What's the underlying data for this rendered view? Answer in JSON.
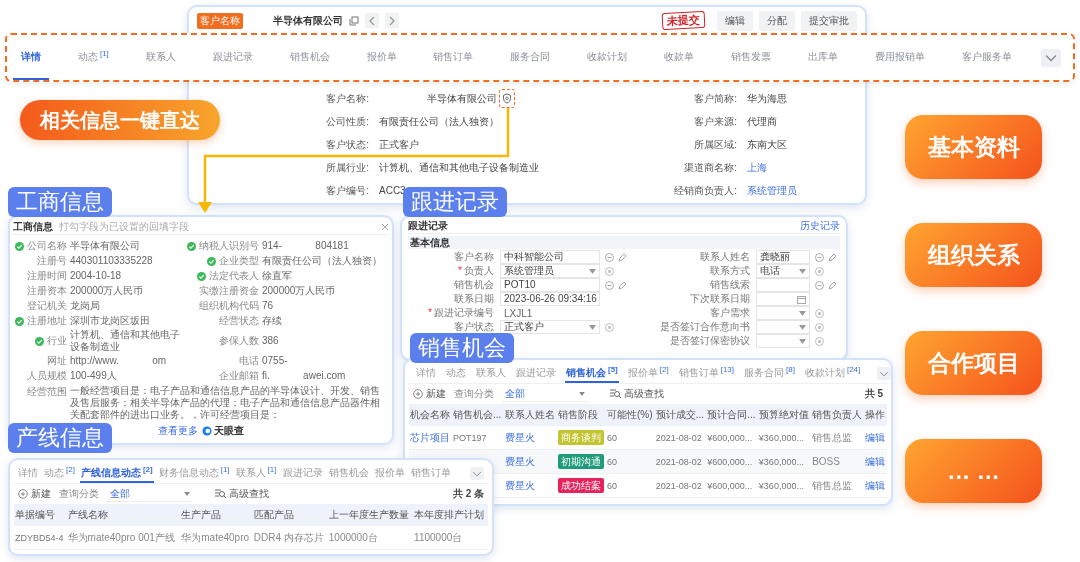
{
  "customer_window": {
    "badge": "客户名称",
    "name": "半导体有限公司",
    "status_stamp": "未提交",
    "buttons": [
      "编辑",
      "分配",
      "提交审批"
    ],
    "rows": [
      {
        "left": {
          "label": "客户名称:",
          "value": "半导体有限公司",
          "link": false,
          "flagged": true
        },
        "right": {
          "label": "客户简称:",
          "value": "华为海思",
          "link": false,
          "flagged": false
        }
      },
      {
        "left": {
          "label": "公司性质:",
          "value": "有限责任公司（法人独资）",
          "link": false,
          "flagged": false
        },
        "right": {
          "label": "客户来源:",
          "value": "代理商",
          "link": false,
          "flagged": false
        }
      },
      {
        "left": {
          "label": "客户状态:",
          "value": "正式客户",
          "link": false,
          "flagged": false
        },
        "right": {
          "label": "所属区域:",
          "value": "东南大区",
          "link": false,
          "flagged": false
        }
      },
      {
        "left": {
          "label": "所属行业:",
          "value": "计算机、通信和其他电子设备制造业",
          "link": false,
          "flagged": false
        },
        "right": {
          "label": "渠道商名称:",
          "value": "上海",
          "link": true,
          "flagged": false
        }
      },
      {
        "left": {
          "label": "客户编号:",
          "value": "ACC3",
          "link": false,
          "flagged": false
        },
        "right": {
          "label": "经销商负责人:",
          "value": "系统管理员",
          "link": true,
          "flagged": false
        }
      }
    ]
  },
  "tab_strip": [
    {
      "label": "详情",
      "selected": true
    },
    {
      "label": "动态",
      "count": "[1]",
      "selected": false
    },
    {
      "label": "联系人",
      "selected": false
    },
    {
      "label": "跟进记录",
      "selected": false
    },
    {
      "label": "销售机会",
      "selected": false
    },
    {
      "label": "报价单",
      "selected": false
    },
    {
      "label": "销售订单",
      "selected": false
    },
    {
      "label": "服务合同",
      "selected": false
    },
    {
      "label": "收款计划",
      "selected": false
    },
    {
      "label": "收款单",
      "selected": false
    },
    {
      "label": "销售发票",
      "selected": false
    },
    {
      "label": "出库单",
      "selected": false
    },
    {
      "label": "费用报销单",
      "selected": false
    },
    {
      "label": "客户服务单",
      "selected": false
    }
  ],
  "callout": "相关信息一键直达",
  "feature_pills": [
    "基本资料",
    "组织关系",
    "合作项目",
    "… …"
  ],
  "business_info": {
    "section_label": "工商信息",
    "title": "工商信息",
    "hint": "打勾字段为已设置的回填字段",
    "rows": [
      {
        "left": {
          "label": "公司名称",
          "value": "半导体有限公司",
          "verified": true
        },
        "right": {
          "label": "纳税人识别号",
          "value": "914-            804181",
          "verified": true
        }
      },
      {
        "left": {
          "label": "注册号",
          "value": "440301103335228",
          "verified": false
        },
        "right": {
          "label": "企业类型",
          "value": "有限责任公司（法人独资）",
          "verified": true
        }
      },
      {
        "left": {
          "label": "注册时间",
          "value": "2004-10-18",
          "verified": false
        },
        "right": {
          "label": "法定代表人",
          "value": "徐直军",
          "verified": true
        }
      },
      {
        "left": {
          "label": "注册资本",
          "value": "200000万人民币",
          "verified": false
        },
        "right": {
          "label": "实缴注册资金",
          "value": "200000万人民币",
          "verified": false
        }
      },
      {
        "left": {
          "label": "登记机关",
          "value": "龙岗局",
          "verified": false
        },
        "right": {
          "label": "组织机构代码",
          "value": "76",
          "verified": false
        }
      },
      {
        "left": {
          "label": "注册地址",
          "value": "深圳市龙岗区坂田",
          "verified": true
        },
        "right": {
          "label": "经营状态",
          "value": "存续",
          "verified": false
        }
      },
      {
        "left": {
          "label": "行业",
          "value": "计算机、通信和其他电子设备制造业",
          "verified": true
        },
        "right": {
          "label": "参保人数",
          "value": "386",
          "verified": false
        }
      },
      {
        "left": {
          "label": "网址",
          "value": "http://www.            om",
          "verified": false
        },
        "right": {
          "label": "电话",
          "value": "0755-",
          "verified": false
        }
      },
      {
        "left": {
          "label": "人员规模",
          "value": "100-499人",
          "verified": false
        },
        "right": {
          "label": "企业邮箱",
          "value": "fi.            awei.com",
          "verified": false
        }
      }
    ],
    "scope": {
      "label": "经营范围",
      "value": "一般经营项目是：电子产品和通信信息产品的半导体设计、开发、销售及售后服务；相关半导体产品的代理；电子产品和通信信息产品器件相关配套部件的进出口业务。，许可经营项目是："
    },
    "more_link": "查看更多",
    "source": "天眼查"
  },
  "follow_up": {
    "section_label": "跟进记录",
    "title": "跟进记录",
    "action": "历史记录",
    "group": "基本信息",
    "rows": [
      {
        "left": {
          "label": "客户名称",
          "value": "中科智能公司",
          "kind": "lookup"
        },
        "right": {
          "label": "联系人姓名",
          "value": "龚晓丽",
          "kind": "lookup"
        }
      },
      {
        "left": {
          "label": "负责人",
          "required_mark": "*",
          "value": "系统管理员",
          "kind": "select"
        },
        "right": {
          "label": "联系方式",
          "value": "电话",
          "kind": "select"
        }
      },
      {
        "left": {
          "label": "销售机会",
          "value": "POT10",
          "kind": "lookup"
        },
        "right": {
          "label": "销售线索",
          "kind": "lookup"
        }
      },
      {
        "left": {
          "label": "联系日期",
          "value": "2023-06-26 09:34:16",
          "kind": "date"
        },
        "right": {
          "label": "下次联系日期",
          "kind": "date"
        }
      },
      {
        "left": {
          "label": "跟进记录编号",
          "required_mark": "*",
          "value": "LXJL1",
          "kind": "plain"
        },
        "right": {
          "label": "客户需求",
          "kind": "select"
        }
      },
      {
        "left": {
          "label": "客户状态",
          "value": "正式客户",
          "kind": "select"
        },
        "right": {
          "label": "是否签订合作意向书",
          "kind": "select"
        }
      },
      {
        "right": {
          "label": "是否签订保密协议",
          "kind": "select"
        }
      }
    ]
  },
  "sales_opportunities": {
    "section_label": "销售机会",
    "tabs": [
      {
        "label": "详情",
        "selected": false
      },
      {
        "label": "动态",
        "selected": false
      },
      {
        "label": "联系人",
        "selected": false
      },
      {
        "label": "跟进记录",
        "selected": false
      },
      {
        "label": "销售机会",
        "count": "[5]",
        "selected": true
      },
      {
        "label": "报价单",
        "count": "[2]",
        "selected": false
      },
      {
        "label": "销售订单",
        "count": "[13]",
        "selected": false
      },
      {
        "label": "服务合同",
        "count": "[8]",
        "selected": false
      },
      {
        "label": "收款计划",
        "count": "[24]",
        "selected": false
      }
    ],
    "toolbar": {
      "new": "新建",
      "filter_label": "查询分类",
      "filter_value": "全部",
      "advanced": "高级查找",
      "total": "共 5"
    },
    "columns": [
      "机会名称",
      "销售机会...",
      "联系人姓名",
      "销售阶段",
      "可能性(%)",
      "预计成交...",
      "预计合同...",
      "预算绝对值",
      "销售负责人",
      "操作"
    ],
    "rows": [
      {
        "name": "芯片项目",
        "code": "POT197",
        "contact": "费星火",
        "stage": "商务谈判",
        "color": "#c3c431",
        "probability": "60",
        "close_date": "2021-08-02",
        "contract": "¥600,000...",
        "budget": "¥360,000...",
        "owner": "销售总监",
        "action": "编辑"
      },
      {
        "contact": "费星火",
        "stage": "初期沟通",
        "color": "#1f9b7b",
        "probability": "60",
        "close_date": "2021-08-02",
        "contract": "¥600,000...",
        "budget": "¥360,000...",
        "owner": "BOSS",
        "action": "编辑"
      },
      {
        "contact": "费星火",
        "stage": "成功结案",
        "color": "#e8235c",
        "probability": "60",
        "close_date": "2021-08-02",
        "contract": "¥600,000...",
        "budget": "¥360,000...",
        "owner": "销售总监",
        "action": "编辑"
      }
    ]
  },
  "production_lines": {
    "section_label": "产线信息",
    "tabs": [
      {
        "label": "详情",
        "selected": false
      },
      {
        "label": "动态",
        "count": "[2]",
        "selected": false
      },
      {
        "label": "产线信息动态",
        "count": "[2]",
        "selected": true
      },
      {
        "label": "财务信息动态",
        "count": "[1]",
        "selected": false
      },
      {
        "label": "联系人",
        "count": "[1]",
        "selected": false
      },
      {
        "label": "跟进记录",
        "selected": false
      },
      {
        "label": "销售机会",
        "selected": false
      },
      {
        "label": "报价单",
        "selected": false
      },
      {
        "label": "销售订单",
        "selected": false
      }
    ],
    "toolbar": {
      "new": "新建",
      "filter_label": "查询分类",
      "filter_value": "全部",
      "advanced": "高级查找",
      "total": "共 2 条"
    },
    "columns": [
      "单据编号",
      "产线名称",
      "生产产品",
      "匹配产品",
      "上一年度生产数量",
      "本年度排产计划"
    ],
    "rows": [
      {
        "cells": [
          "ZDYBD54-4",
          "华为mate40pro 001产线",
          "华为mate40pro",
          "DDR4 内存芯片",
          "1000000台",
          "1100000台"
        ]
      }
    ]
  }
}
